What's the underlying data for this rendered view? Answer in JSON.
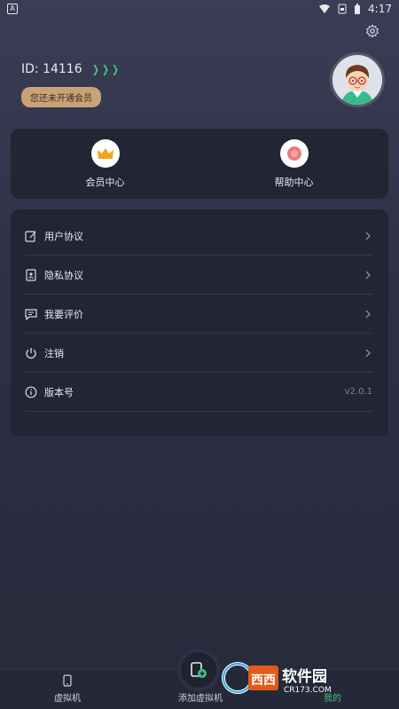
{
  "status": {
    "time": "4:17",
    "left_badge": "A"
  },
  "profile": {
    "id_label": "ID: 14116",
    "member_status": "您还未开通会员"
  },
  "shortcuts": [
    {
      "label": "会员中心",
      "icon": "crown-icon"
    },
    {
      "label": "帮助中心",
      "icon": "help-icon"
    }
  ],
  "menu": [
    {
      "label": "用户协议",
      "icon": "edit-icon"
    },
    {
      "label": "隐私协议",
      "icon": "privacy-icon"
    },
    {
      "label": "我要评价",
      "icon": "comment-icon"
    },
    {
      "label": "注销",
      "icon": "power-icon"
    },
    {
      "label": "版本号",
      "icon": "info-icon",
      "value": "v2.0.1"
    }
  ],
  "tabs": {
    "vm": "虚拟机",
    "add_vm": "添加虚拟机",
    "mine": "我的"
  },
  "watermark": {
    "brand": "西西软件园",
    "site": "CR173.COM"
  },
  "colors": {
    "accent_green": "#3ec77a",
    "member_badge": "#caa277"
  }
}
